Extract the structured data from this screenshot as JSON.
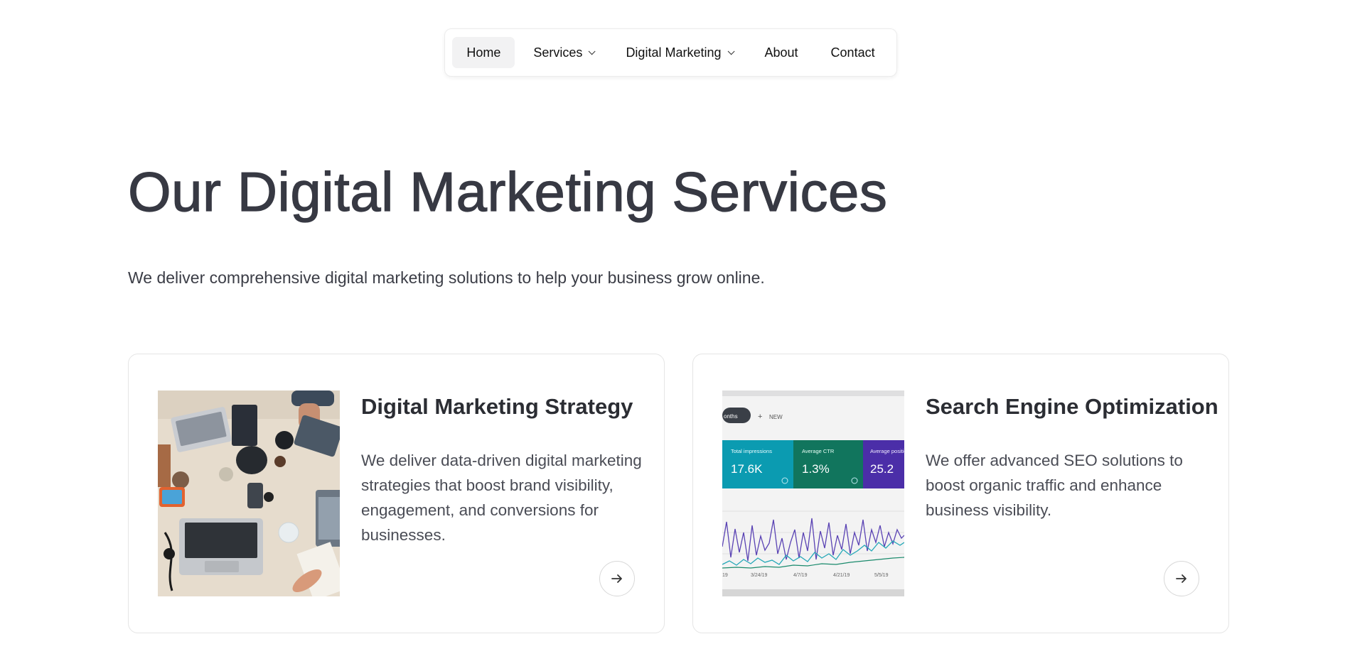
{
  "nav": {
    "items": [
      {
        "label": "Home",
        "active": true,
        "has_dropdown": false
      },
      {
        "label": "Services",
        "active": false,
        "has_dropdown": true
      },
      {
        "label": "Digital Marketing",
        "active": false,
        "has_dropdown": true
      },
      {
        "label": "About",
        "active": false,
        "has_dropdown": false
      },
      {
        "label": "Contact",
        "active": false,
        "has_dropdown": false
      }
    ]
  },
  "hero": {
    "title": "Our Digital Marketing Services",
    "subtitle": "We deliver comprehensive digital marketing solutions to help your business grow online."
  },
  "cards": [
    {
      "title": "Digital Marketing Strategy",
      "description": "We deliver data-driven digital marketing strategies that boost brand visibility, engagement, and conversions for businesses.",
      "image": "photo-desk-laptops",
      "action_icon": "arrow-right-icon"
    },
    {
      "title": "Search Engine Optimization",
      "description": "We offer advanced SEO solutions to boost organic traffic and enhance business visibility.",
      "image": "photo-analytics-screen",
      "action_icon": "arrow-right-icon",
      "image_text": {
        "chip": "onths",
        "new_label": "NEW",
        "metrics": [
          {
            "label": "Total impressions",
            "value": "17.6K"
          },
          {
            "label": "Average CTR",
            "value": "1.3%"
          },
          {
            "label": "Average position",
            "value": "25.2"
          }
        ],
        "dates": [
          "19",
          "3/24/19",
          "4/7/19",
          "4/21/19",
          "5/5/19"
        ]
      }
    }
  ],
  "colors": {
    "text_dark": "#373943",
    "nav_active_bg": "#f2f2f3",
    "card_border": "#e5e5e5",
    "metric_teal": "#0b9bb1",
    "metric_green": "#11755d",
    "metric_purple": "#4b2ea8"
  }
}
